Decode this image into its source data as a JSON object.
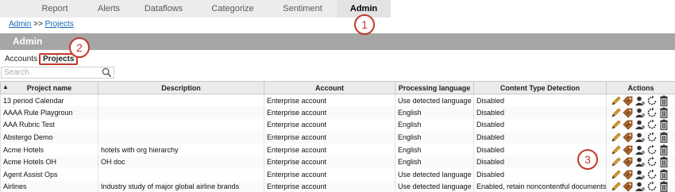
{
  "nav": {
    "tabs": [
      {
        "label": "Report"
      },
      {
        "label": "Alerts"
      },
      {
        "label": "Dataflows"
      },
      {
        "label": "Categorize"
      },
      {
        "label": "Sentiment"
      },
      {
        "label": "Admin"
      }
    ]
  },
  "breadcrumb": {
    "root": "Admin",
    "separator": ">>",
    "current": "Projects"
  },
  "section_title": "Admin",
  "subtabs": [
    {
      "label": "Accounts"
    },
    {
      "label": "Projects"
    }
  ],
  "search": {
    "placeholder": "Search",
    "value": ""
  },
  "table": {
    "headers": [
      "Project name",
      "Description",
      "Account",
      "Processing language",
      "Content Type Detection",
      "Actions"
    ],
    "sort_indicator": "▲",
    "rows": [
      {
        "name": "13 period Calendar",
        "description": "",
        "account": "Enterprise account",
        "language": "Use detected language",
        "detection": "Disabled"
      },
      {
        "name": "AAAA Rule Playgroun",
        "description": "",
        "account": "Enterprise account",
        "language": "English",
        "detection": "Disabled"
      },
      {
        "name": "AAA Rubric Test",
        "description": "",
        "account": "Enterprise account",
        "language": "English",
        "detection": "Disabled"
      },
      {
        "name": "Abstergo Demo",
        "description": "",
        "account": "Enterprise account",
        "language": "English",
        "detection": "Disabled"
      },
      {
        "name": "Acme Hotels",
        "description": "hotels with org hierarchy",
        "account": "Enterprise account",
        "language": "English",
        "detection": "Disabled"
      },
      {
        "name": "Acme Hotels OH",
        "description": "OH doc",
        "account": "Enterprise account",
        "language": "English",
        "detection": "Disabled"
      },
      {
        "name": "Agent Assist Ops",
        "description": "",
        "account": "Enterprise account",
        "language": "Use detected language",
        "detection": "Disabled"
      },
      {
        "name": "Airlines",
        "description": "Industry study of major global airline brands",
        "account": "Enterprise account",
        "language": "Use detected language",
        "detection": "Enabled, retain noncontentful documents"
      }
    ],
    "action_icons": [
      "pencil-icon",
      "tag-icon",
      "user-icon",
      "refresh-icon",
      "trash-icon"
    ]
  },
  "markers": [
    "1",
    "2",
    "3"
  ],
  "colors": {
    "accent_marker": "#c0392b",
    "admin_bar": "#a6a6a6",
    "link": "#1a66b8"
  }
}
